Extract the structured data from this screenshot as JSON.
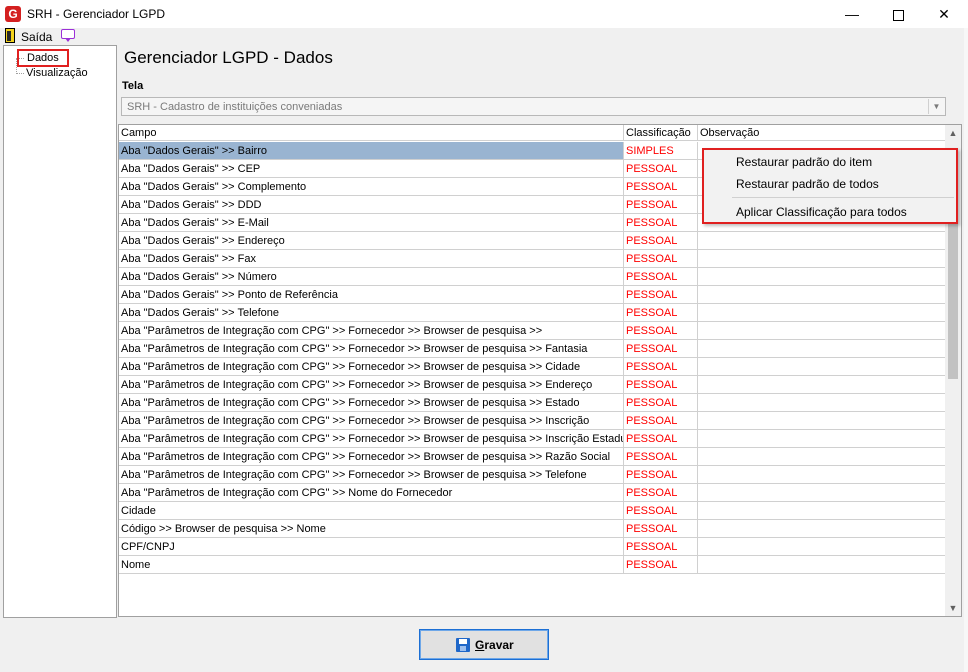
{
  "window": {
    "title": "SRH - Gerenciador LGPD",
    "app_icon_letter": "G",
    "minimize": "—",
    "close": "✕"
  },
  "menu": {
    "exit_label": "Saída"
  },
  "tree": {
    "items": [
      {
        "label": "Dados",
        "selected": true
      },
      {
        "label": "Visualização",
        "selected": false
      }
    ]
  },
  "main": {
    "title": "Gerenciador LGPD - Dados",
    "tela_label": "Tela",
    "tela_value": "SRH - Cadastro de instituições conveniadas"
  },
  "grid": {
    "columns": [
      "Campo",
      "Classificação",
      "Observação"
    ],
    "rows": [
      {
        "campo": "Aba \"Dados Gerais\" >> Bairro",
        "classificacao": "SIMPLES",
        "observacao": ""
      },
      {
        "campo": "Aba \"Dados Gerais\" >> CEP",
        "classificacao": "PESSOAL",
        "observacao": ""
      },
      {
        "campo": "Aba \"Dados Gerais\" >> Complemento",
        "classificacao": "PESSOAL",
        "observacao": ""
      },
      {
        "campo": "Aba \"Dados Gerais\" >> DDD",
        "classificacao": "PESSOAL",
        "observacao": ""
      },
      {
        "campo": "Aba \"Dados Gerais\" >> E-Mail",
        "classificacao": "PESSOAL",
        "observacao": ""
      },
      {
        "campo": "Aba \"Dados Gerais\" >> Endereço",
        "classificacao": "PESSOAL",
        "observacao": ""
      },
      {
        "campo": "Aba \"Dados Gerais\" >> Fax",
        "classificacao": "PESSOAL",
        "observacao": ""
      },
      {
        "campo": "Aba \"Dados Gerais\" >> Número",
        "classificacao": "PESSOAL",
        "observacao": ""
      },
      {
        "campo": "Aba \"Dados Gerais\" >> Ponto de Referência",
        "classificacao": "PESSOAL",
        "observacao": ""
      },
      {
        "campo": "Aba \"Dados Gerais\" >> Telefone",
        "classificacao": "PESSOAL",
        "observacao": ""
      },
      {
        "campo": "Aba \"Parâmetros de Integração com CPG\" >> Fornecedor >> Browser de pesquisa >>",
        "classificacao": "PESSOAL",
        "observacao": ""
      },
      {
        "campo": "Aba \"Parâmetros de Integração com CPG\" >> Fornecedor >> Browser de pesquisa >>  Fantasia",
        "classificacao": "PESSOAL",
        "observacao": ""
      },
      {
        "campo": "Aba \"Parâmetros de Integração com CPG\" >> Fornecedor >> Browser de pesquisa >> Cidade",
        "classificacao": "PESSOAL",
        "observacao": ""
      },
      {
        "campo": "Aba \"Parâmetros de Integração com CPG\" >> Fornecedor >> Browser de pesquisa >> Endereço",
        "classificacao": "PESSOAL",
        "observacao": ""
      },
      {
        "campo": "Aba \"Parâmetros de Integração com CPG\" >> Fornecedor >> Browser de pesquisa >> Estado",
        "classificacao": "PESSOAL",
        "observacao": ""
      },
      {
        "campo": "Aba \"Parâmetros de Integração com CPG\" >> Fornecedor >> Browser de pesquisa >> Inscrição",
        "classificacao": "PESSOAL",
        "observacao": ""
      },
      {
        "campo": "Aba \"Parâmetros de Integração com CPG\" >> Fornecedor >> Browser de pesquisa >> Inscrição Estadual",
        "classificacao": "PESSOAL",
        "observacao": ""
      },
      {
        "campo": "Aba \"Parâmetros de Integração com CPG\" >> Fornecedor >> Browser de pesquisa >> Razão Social",
        "classificacao": "PESSOAL",
        "observacao": ""
      },
      {
        "campo": "Aba \"Parâmetros de Integração com CPG\" >> Fornecedor >> Browser de pesquisa >> Telefone",
        "classificacao": "PESSOAL",
        "observacao": ""
      },
      {
        "campo": "Aba \"Parâmetros de Integração com CPG\" >> Nome do Fornecedor",
        "classificacao": "PESSOAL",
        "observacao": ""
      },
      {
        "campo": "Cidade",
        "classificacao": "PESSOAL",
        "observacao": ""
      },
      {
        "campo": "Código >> Browser de pesquisa >> Nome",
        "classificacao": "PESSOAL",
        "observacao": ""
      },
      {
        "campo": "CPF/CNPJ",
        "classificacao": "PESSOAL",
        "observacao": ""
      },
      {
        "campo": "Nome",
        "classificacao": "PESSOAL",
        "observacao": ""
      }
    ]
  },
  "context_menu": {
    "items": [
      "Restaurar padrão do item",
      "Restaurar padrão de todos",
      "Aplicar Classificação para todos"
    ]
  },
  "buttons": {
    "save_accel": "G",
    "save_rest": "ravar"
  },
  "colors": {
    "classification_text": "#ff0000",
    "selected_row": "#99b4d1",
    "highlight_border": "#e02020"
  }
}
